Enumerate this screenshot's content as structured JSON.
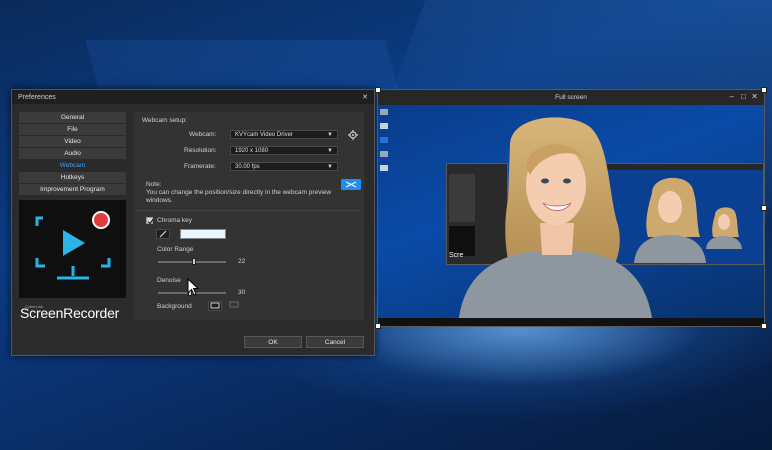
{
  "preferences": {
    "title": "Preferences",
    "nav": [
      {
        "label": "General",
        "active": false
      },
      {
        "label": "File",
        "active": false
      },
      {
        "label": "Video",
        "active": false
      },
      {
        "label": "Audio",
        "active": false
      },
      {
        "label": "Webcam",
        "active": true
      },
      {
        "label": "Hotkeys",
        "active": false
      },
      {
        "label": "Improvement Program",
        "active": false
      }
    ],
    "brand_small": "CyberLink",
    "brand": "ScreenRecorder",
    "webcam_setup": {
      "heading": "Webcam setup:",
      "webcam_label": "Webcam:",
      "webcam_value": "KVYcam Video Driver",
      "resolution_label": "Resolution:",
      "resolution_value": "1920 x 1080",
      "framerate_label": "Framerate:",
      "framerate_value": "30.00 fps",
      "note_label": "Note:",
      "note_text": "You can change the position/size directly in the webcam preview windows."
    },
    "chroma": {
      "label": "Chroma key",
      "checked": true,
      "key_color": "#e9f6ff",
      "color_range_label": "Color Range",
      "color_range_value": "22",
      "denoise_label": "Denoise",
      "denoise_value": "30",
      "background_label": "Background"
    },
    "ok_label": "OK",
    "cancel_label": "Cancel"
  },
  "full_screen": {
    "title": "Full screen",
    "nested_brand": "Scre"
  },
  "colors": {
    "accent": "#3ea1ff",
    "dialog_bg": "#2b2b2b",
    "logo_cyan": "#2ab4e6",
    "record_red": "#e33c3c"
  }
}
